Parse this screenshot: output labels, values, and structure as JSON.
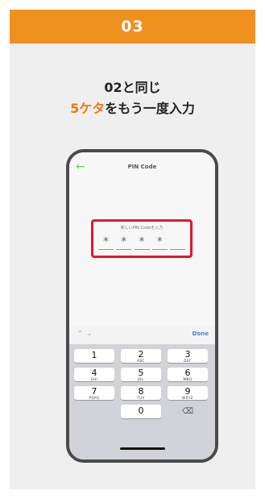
{
  "step": {
    "number": "03"
  },
  "instruction": {
    "line1": "02と同じ",
    "line2_accent": "5ケタ",
    "line2_rest": "をもう一度入力"
  },
  "phone": {
    "header": {
      "back_icon": "back-arrow-icon",
      "title": "PIN Code"
    },
    "pin_entry": {
      "hint": "新しいPIN Codeを入力",
      "slots": [
        "*",
        "*",
        "*",
        "*",
        ""
      ]
    },
    "keyboard": {
      "toolbar": {
        "up_icon": "chevron-up-icon",
        "down_icon": "chevron-down-icon",
        "done": "Done"
      },
      "keys": [
        {
          "num": "1",
          "sub": ""
        },
        {
          "num": "2",
          "sub": "ABC"
        },
        {
          "num": "3",
          "sub": "DEF"
        },
        {
          "num": "4",
          "sub": "GHI"
        },
        {
          "num": "5",
          "sub": "JKL"
        },
        {
          "num": "6",
          "sub": "MNO"
        },
        {
          "num": "7",
          "sub": "PQRS"
        },
        {
          "num": "8",
          "sub": "TUV"
        },
        {
          "num": "9",
          "sub": "WXYZ"
        },
        {
          "num": "0",
          "sub": ""
        }
      ],
      "delete_icon": "backspace-icon"
    }
  },
  "colors": {
    "accent": "#f0901e",
    "highlight_border": "#e0182d"
  }
}
